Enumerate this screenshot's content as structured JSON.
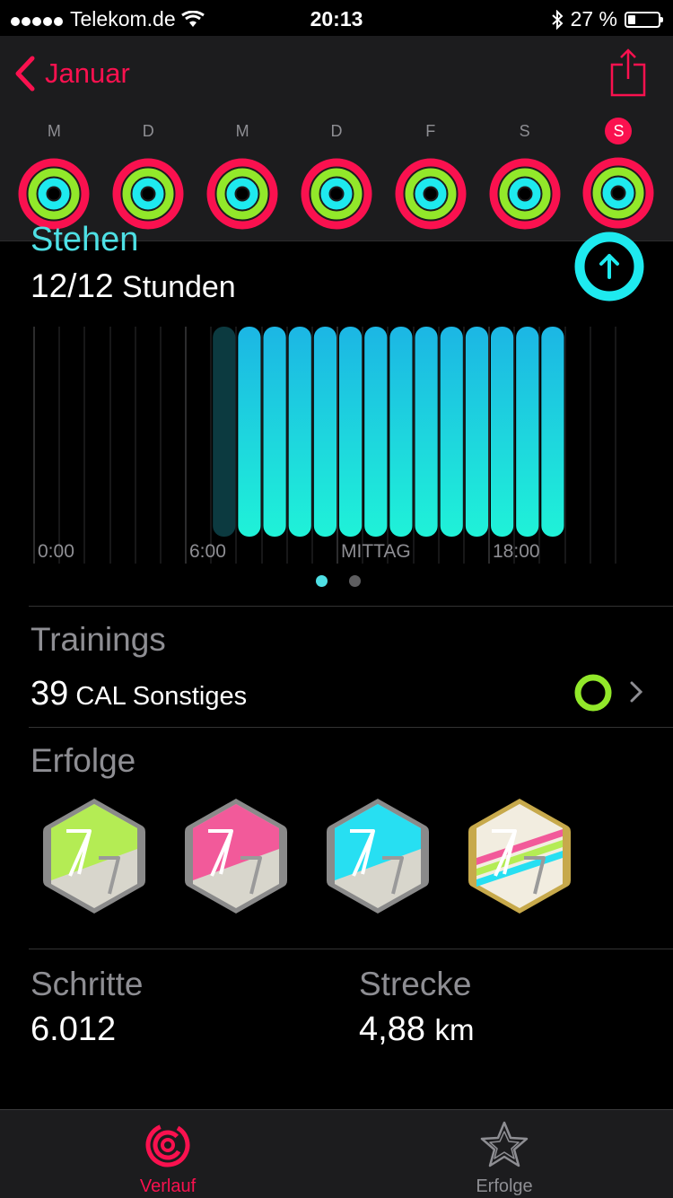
{
  "status": {
    "carrier": "Telekom.de",
    "time": "20:13",
    "battery": "27 %"
  },
  "header": {
    "back_label": "Januar"
  },
  "week": [
    {
      "label": "M",
      "today": false
    },
    {
      "label": "D",
      "today": false
    },
    {
      "label": "M",
      "today": false
    },
    {
      "label": "D",
      "today": false
    },
    {
      "label": "F",
      "today": false
    },
    {
      "label": "S",
      "today": false
    },
    {
      "label": "S",
      "today": true
    }
  ],
  "stand": {
    "title": "Stehen",
    "value": "12/12",
    "unit": "Stunden",
    "axis_labels": [
      "0:00",
      "6:00",
      "MITTAG",
      "18:00"
    ],
    "hours_active": [
      0,
      0,
      0,
      0,
      0,
      0,
      0,
      0,
      1,
      1,
      1,
      1,
      1,
      1,
      1,
      1,
      1,
      1,
      1,
      1,
      1,
      0,
      0,
      0
    ],
    "hours_dim": [
      7
    ]
  },
  "trainings": {
    "title": "Trainings",
    "value": "39",
    "unit": "CAL",
    "type": "Sonstiges"
  },
  "achievements": {
    "title": "Erfolge",
    "badges": [
      "move-badge-icon",
      "exercise-badge-icon",
      "stand-badge-icon",
      "perfect-week-badge-icon"
    ]
  },
  "stats": {
    "steps_label": "Schritte",
    "steps_value": "6.012",
    "distance_label": "Strecke",
    "distance_value": "4,88",
    "distance_unit": "km"
  },
  "tabbar": {
    "history_label": "Verlauf",
    "awards_label": "Erfolge"
  },
  "colors": {
    "move": "#fa114f",
    "exercise": "#92e82a",
    "stand": "#1eeaef",
    "accent": "#fa114f"
  }
}
